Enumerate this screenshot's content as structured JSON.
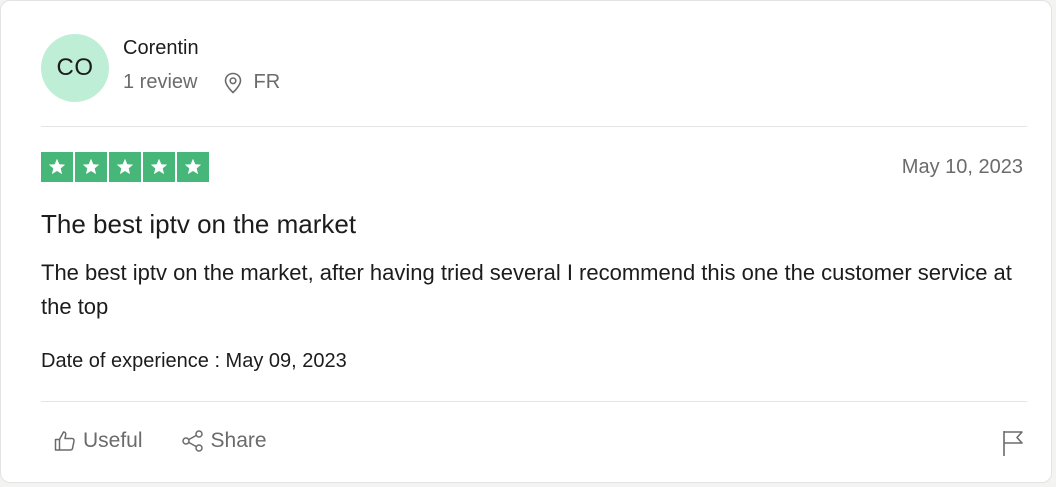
{
  "reviewer": {
    "initials": "CO",
    "name": "Corentin",
    "review_count": "1 review",
    "country": "FR",
    "avatar_color": "#bfeed6"
  },
  "rating": {
    "stars": 5,
    "max_stars": 5,
    "star_color": "#46b679"
  },
  "review": {
    "published_date": "May 10, 2023",
    "title": "The best iptv on the market",
    "body": "The best iptv on the market, after having tried several I recommend this one the customer service at the top",
    "date_of_experience": "Date of experience : May 09, 2023"
  },
  "actions": {
    "useful_label": "Useful",
    "share_label": "Share",
    "useful_icon": "thumbs-up-icon",
    "share_icon": "share-icon",
    "report_icon": "flag-icon"
  }
}
